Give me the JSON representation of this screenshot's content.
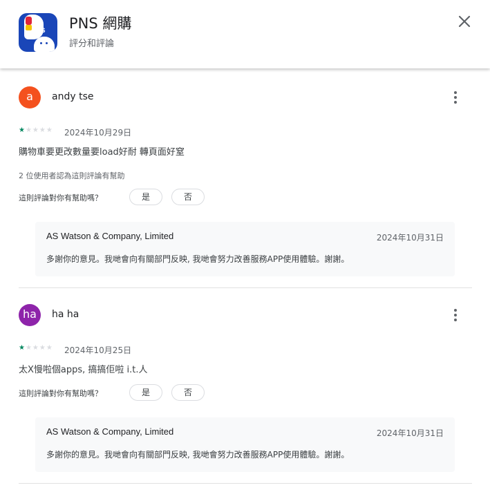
{
  "header": {
    "app_icon": "pns-app-icon",
    "icon_text": "PNS",
    "title": "PNS 網購",
    "subtitle": "評分和評論",
    "close_icon": "close-icon"
  },
  "reviews": [
    {
      "avatar_letter": "a",
      "avatar_color": "#f4511e",
      "author": "andy tse",
      "rating": 1,
      "max_rating": 5,
      "date": "2024年10月29日",
      "text": "購物車要更改數量要load好耐 轉頁面好窒",
      "helpful_count_text": "2 位使用者認為這則評論有幫助",
      "helpful_question": "這則評論對你有幫助嗎？",
      "yes_label": "是",
      "no_label": "否",
      "reply": {
        "developer": "AS Watson & Company, Limited",
        "date": "2024年10月31日",
        "text": "多謝你的意見。我哋會向有關部門反映, 我哋會努力改善服務APP使用體驗。謝謝。"
      }
    },
    {
      "avatar_letter": "ha",
      "avatar_color": "#8e24aa",
      "author": "ha ha",
      "rating": 1,
      "max_rating": 5,
      "date": "2024年10月25日",
      "text": "太X慢啦個apps, 搞搞佢啦 i.t.人",
      "helpful_question": "這則評論對你有幫助嗎？",
      "yes_label": "是",
      "no_label": "否",
      "reply": {
        "developer": "AS Watson & Company, Limited",
        "date": "2024年10月31日",
        "text": "多謝你的意見。我哋會向有關部門反映, 我哋會努力改善服務APP使用體驗。謝謝。"
      }
    }
  ],
  "colors": {
    "star_filled": "#01875f",
    "star_empty": "#dadce0"
  }
}
